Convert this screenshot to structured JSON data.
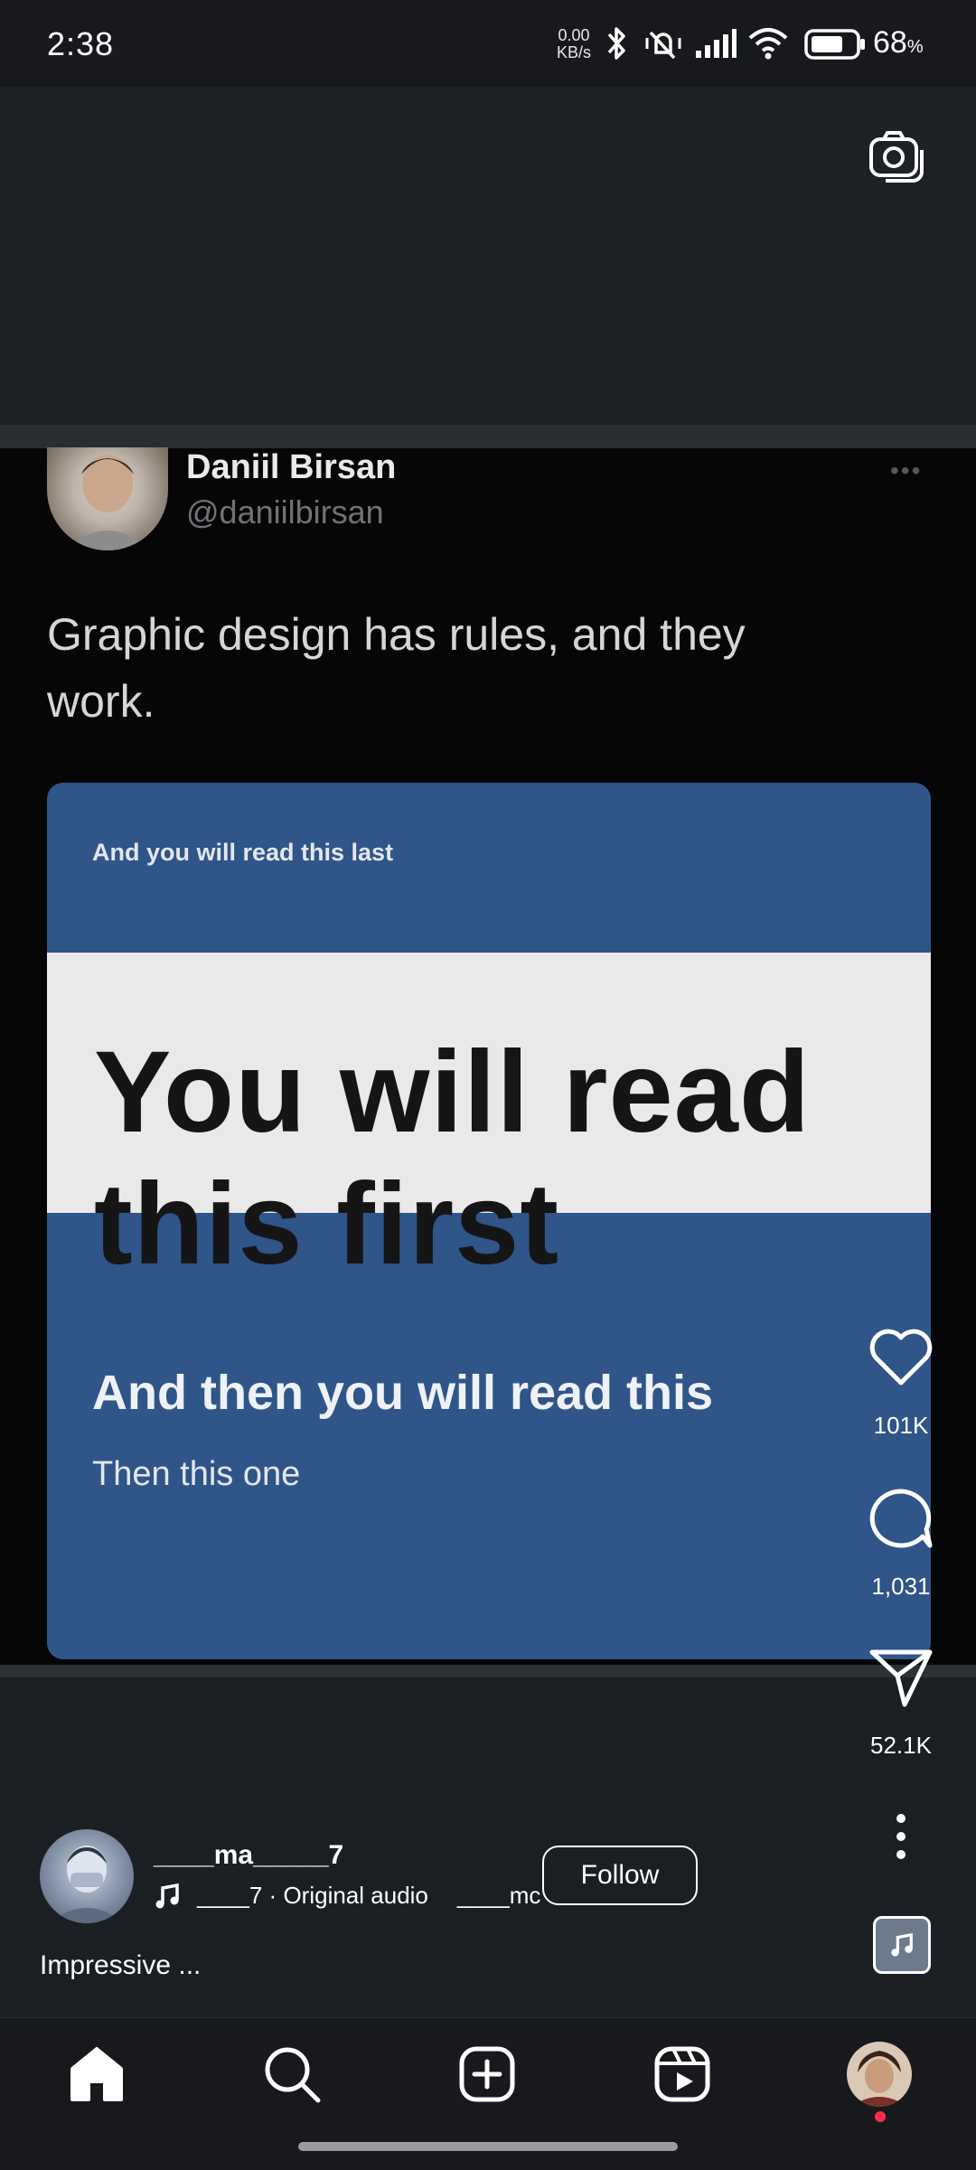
{
  "status_bar": {
    "time": "2:38",
    "net_speed_value": "0.00",
    "net_speed_unit": "KB/s",
    "battery_percent": "68",
    "battery_unit": "%"
  },
  "tweet": {
    "author_name": "Daniil Birsan",
    "author_handle": "@daniilbirsan",
    "more": "•••",
    "text": "Graphic design has rules, and they work.",
    "graphic": {
      "top_line": "And you will read this last",
      "headline": "You will read this first",
      "middle_line": "And then you will read this",
      "bottom_line": "Then this one"
    }
  },
  "actions": {
    "likes": "101K",
    "comments": "1,031",
    "shares": "52.1K"
  },
  "reel": {
    "username": "____ma_____7",
    "audio_owner": "____7",
    "audio_separator": "·",
    "audio_label": "Original audio",
    "audio_scroll": "____mc",
    "follow_label": "Follow",
    "caption": "Impressive ..."
  },
  "colors": {
    "graphic_blue": "#2f5589",
    "background": "#1b1e22",
    "notification_dot": "#ff2d4a"
  }
}
